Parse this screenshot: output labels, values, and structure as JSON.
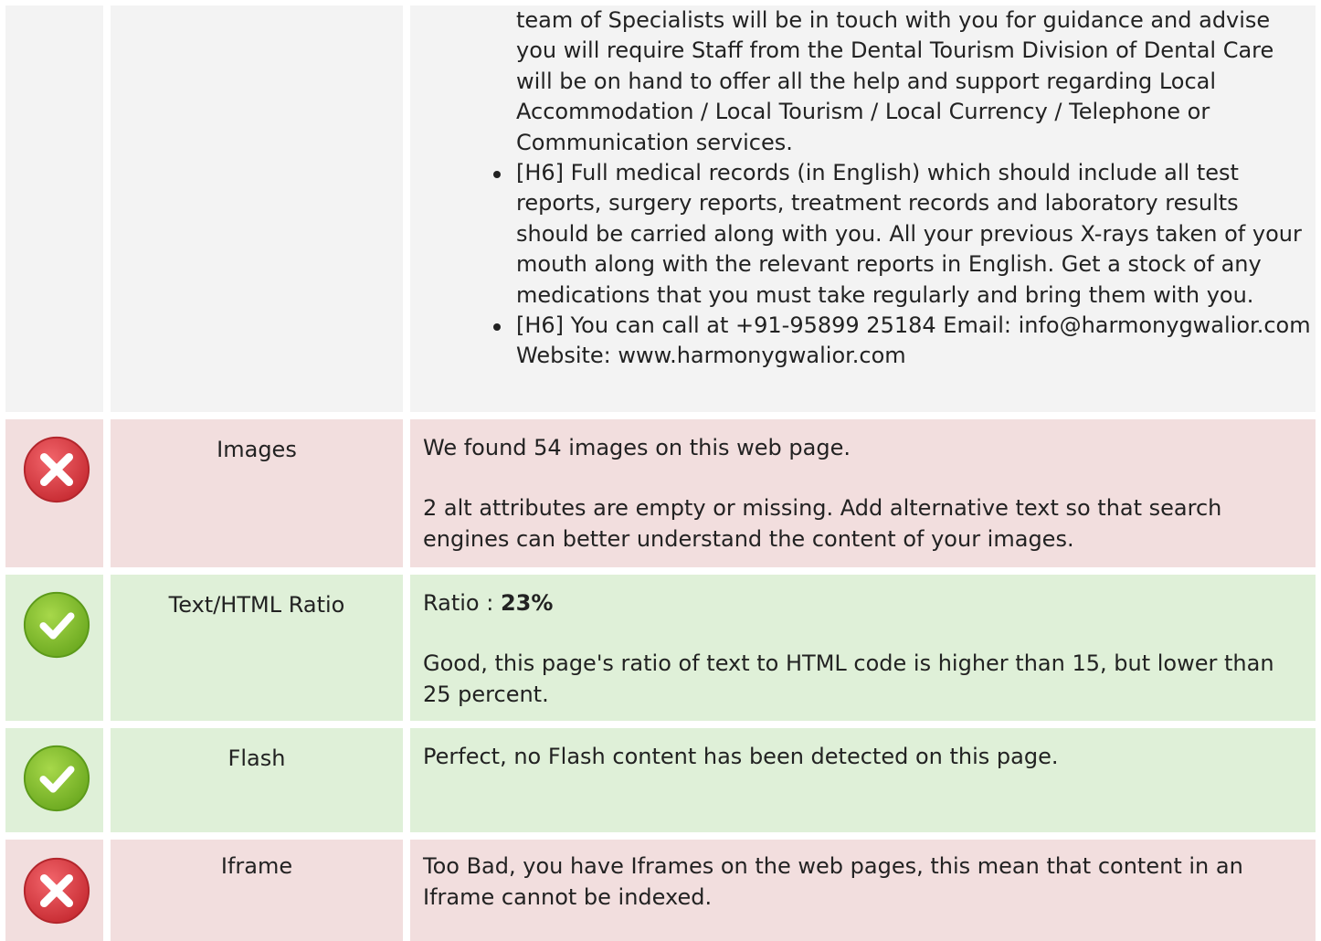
{
  "headings_section": {
    "continued_text": "team of Specialists will be in touch with you for guidance and advise you will require Staff from the Dental Tourism Division of Dental Care will be on hand to offer all the help and support regarding Local Accommodation / Local Tourism / Local Currency / Telephone or Communication services.",
    "items": [
      "[H6] Full medical records (in English) which should include all test reports, surgery reports, treatment records and laboratory results should be carried along with you. All your previous X-rays taken of your mouth along with the relevant reports in English. Get a stock of any medications that you must take regularly and bring them with you.",
      "[H6] You can call at +91-95899 25184 Email: info@harmonygwalior.com Website: www.harmonygwalior.com"
    ]
  },
  "checks": [
    {
      "status": "error",
      "label": "Images",
      "paragraphs": [
        "We found 54 images on this web page.",
        "2 alt attributes are empty or missing. Add alternative text so that search engines can better understand the content of your images."
      ]
    },
    {
      "status": "ok",
      "label": "Text/HTML Ratio",
      "ratio_prefix": "Ratio : ",
      "ratio_value": "23%",
      "paragraphs": [
        "Good, this page's ratio of text to HTML code is higher than 15, but lower than 25 percent."
      ]
    },
    {
      "status": "ok",
      "label": "Flash",
      "paragraphs": [
        "Perfect, no Flash content has been detected on this page."
      ]
    },
    {
      "status": "error",
      "label": "Iframe",
      "paragraphs": [
        "Too Bad, you have Iframes on the web pages, this mean that content in an Iframe cannot be indexed."
      ]
    }
  ],
  "colors": {
    "error_bg": "#f2dede",
    "ok_bg": "#dff0d8",
    "neutral_bg": "#f3f3f3",
    "error_icon": "#d9363e",
    "ok_icon": "#7cb82f"
  },
  "icons": {
    "error": "x-circle-icon",
    "ok": "check-circle-icon"
  }
}
